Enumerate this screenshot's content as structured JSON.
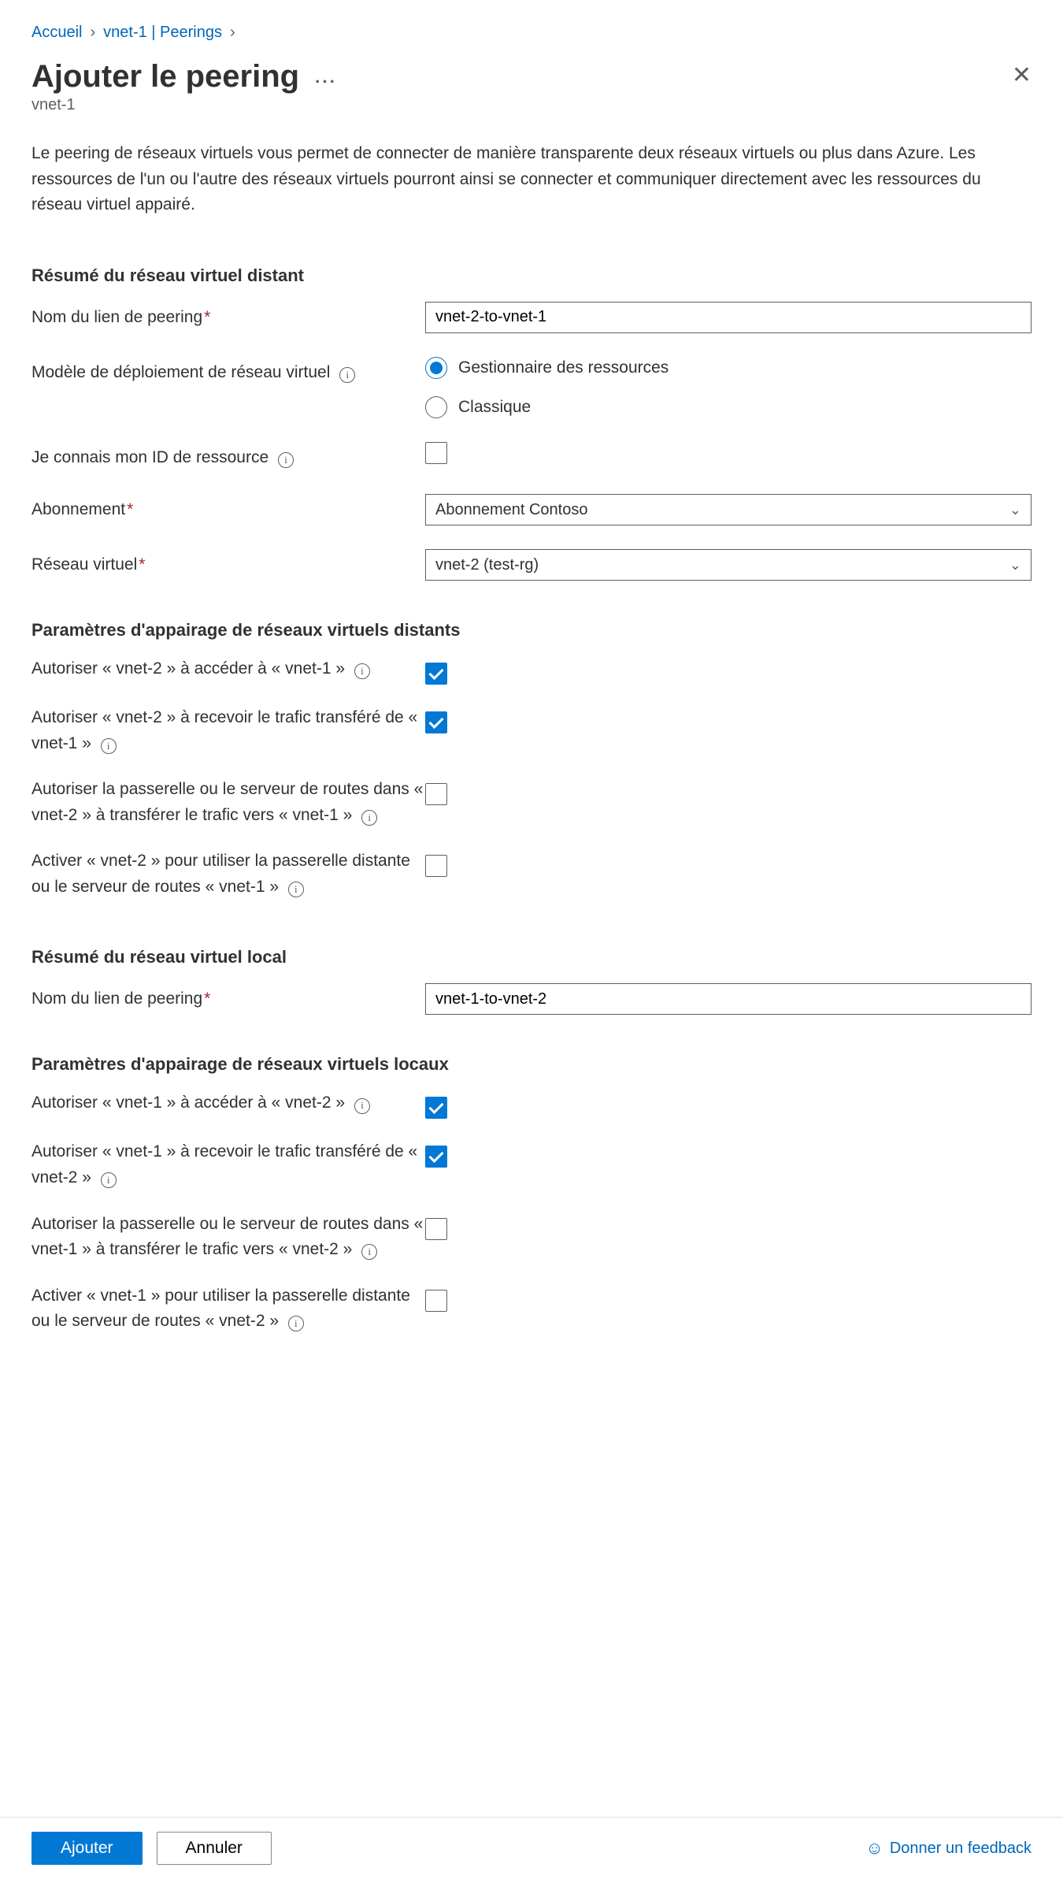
{
  "breadcrumb": {
    "home": "Accueil",
    "parent": "vnet-1 | Peerings"
  },
  "header": {
    "title": "Ajouter le peering",
    "subtitle": "vnet-1"
  },
  "intro": "Le peering de réseaux virtuels vous permet de connecter de manière transparente deux réseaux virtuels ou plus dans Azure. Les ressources de l'un ou l'autre des réseaux virtuels pourront ainsi se connecter et communiquer directement avec les ressources du réseau virtuel appairé.",
  "sections": {
    "remote_summary": "Résumé du réseau virtuel distant",
    "remote_params": "Paramètres d'appairage de réseaux virtuels distants",
    "local_summary": "Résumé du réseau virtuel local",
    "local_params": "Paramètres d'appairage de réseaux virtuels locaux"
  },
  "labels": {
    "peering_link_name": "Nom du lien de peering",
    "deployment_model": "Modèle de déploiement de réseau virtuel",
    "know_resource_id": "Je connais mon ID de ressource",
    "subscription": "Abonnement",
    "vnet": "Réseau virtuel"
  },
  "radios": {
    "resource_manager": "Gestionnaire des ressources",
    "classic": "Classique"
  },
  "values": {
    "remote_link_name": "vnet-2-to-vnet-1",
    "subscription": "Abonnement Contoso",
    "vnet": "vnet-2 (test-rg)",
    "local_link_name": "vnet-1-to-vnet-2"
  },
  "remote_checks": {
    "allow_access": "Autoriser « vnet-2 » à accéder à « vnet-1 »",
    "allow_forwarded": "Autoriser « vnet-2 » à recevoir le trafic transféré de « vnet-1 »",
    "allow_gateway": "Autoriser la passerelle ou le serveur de routes dans « vnet-2 » à transférer le trafic vers « vnet-1 »",
    "use_remote_gw": "Activer « vnet-2 » pour utiliser la passerelle distante ou le serveur de routes « vnet-1 »"
  },
  "local_checks": {
    "allow_access": "Autoriser « vnet-1 » à accéder à « vnet-2 »",
    "allow_forwarded": "Autoriser « vnet-1 » à recevoir le trafic transféré de « vnet-2 »",
    "allow_gateway": "Autoriser la passerelle ou le serveur de routes dans « vnet-1 » à transférer le trafic vers « vnet-2 »",
    "use_remote_gw": "Activer « vnet-1 » pour utiliser la passerelle distante ou le serveur de routes « vnet-2 »"
  },
  "footer": {
    "add": "Ajouter",
    "cancel": "Annuler",
    "feedback": "Donner un feedback"
  }
}
